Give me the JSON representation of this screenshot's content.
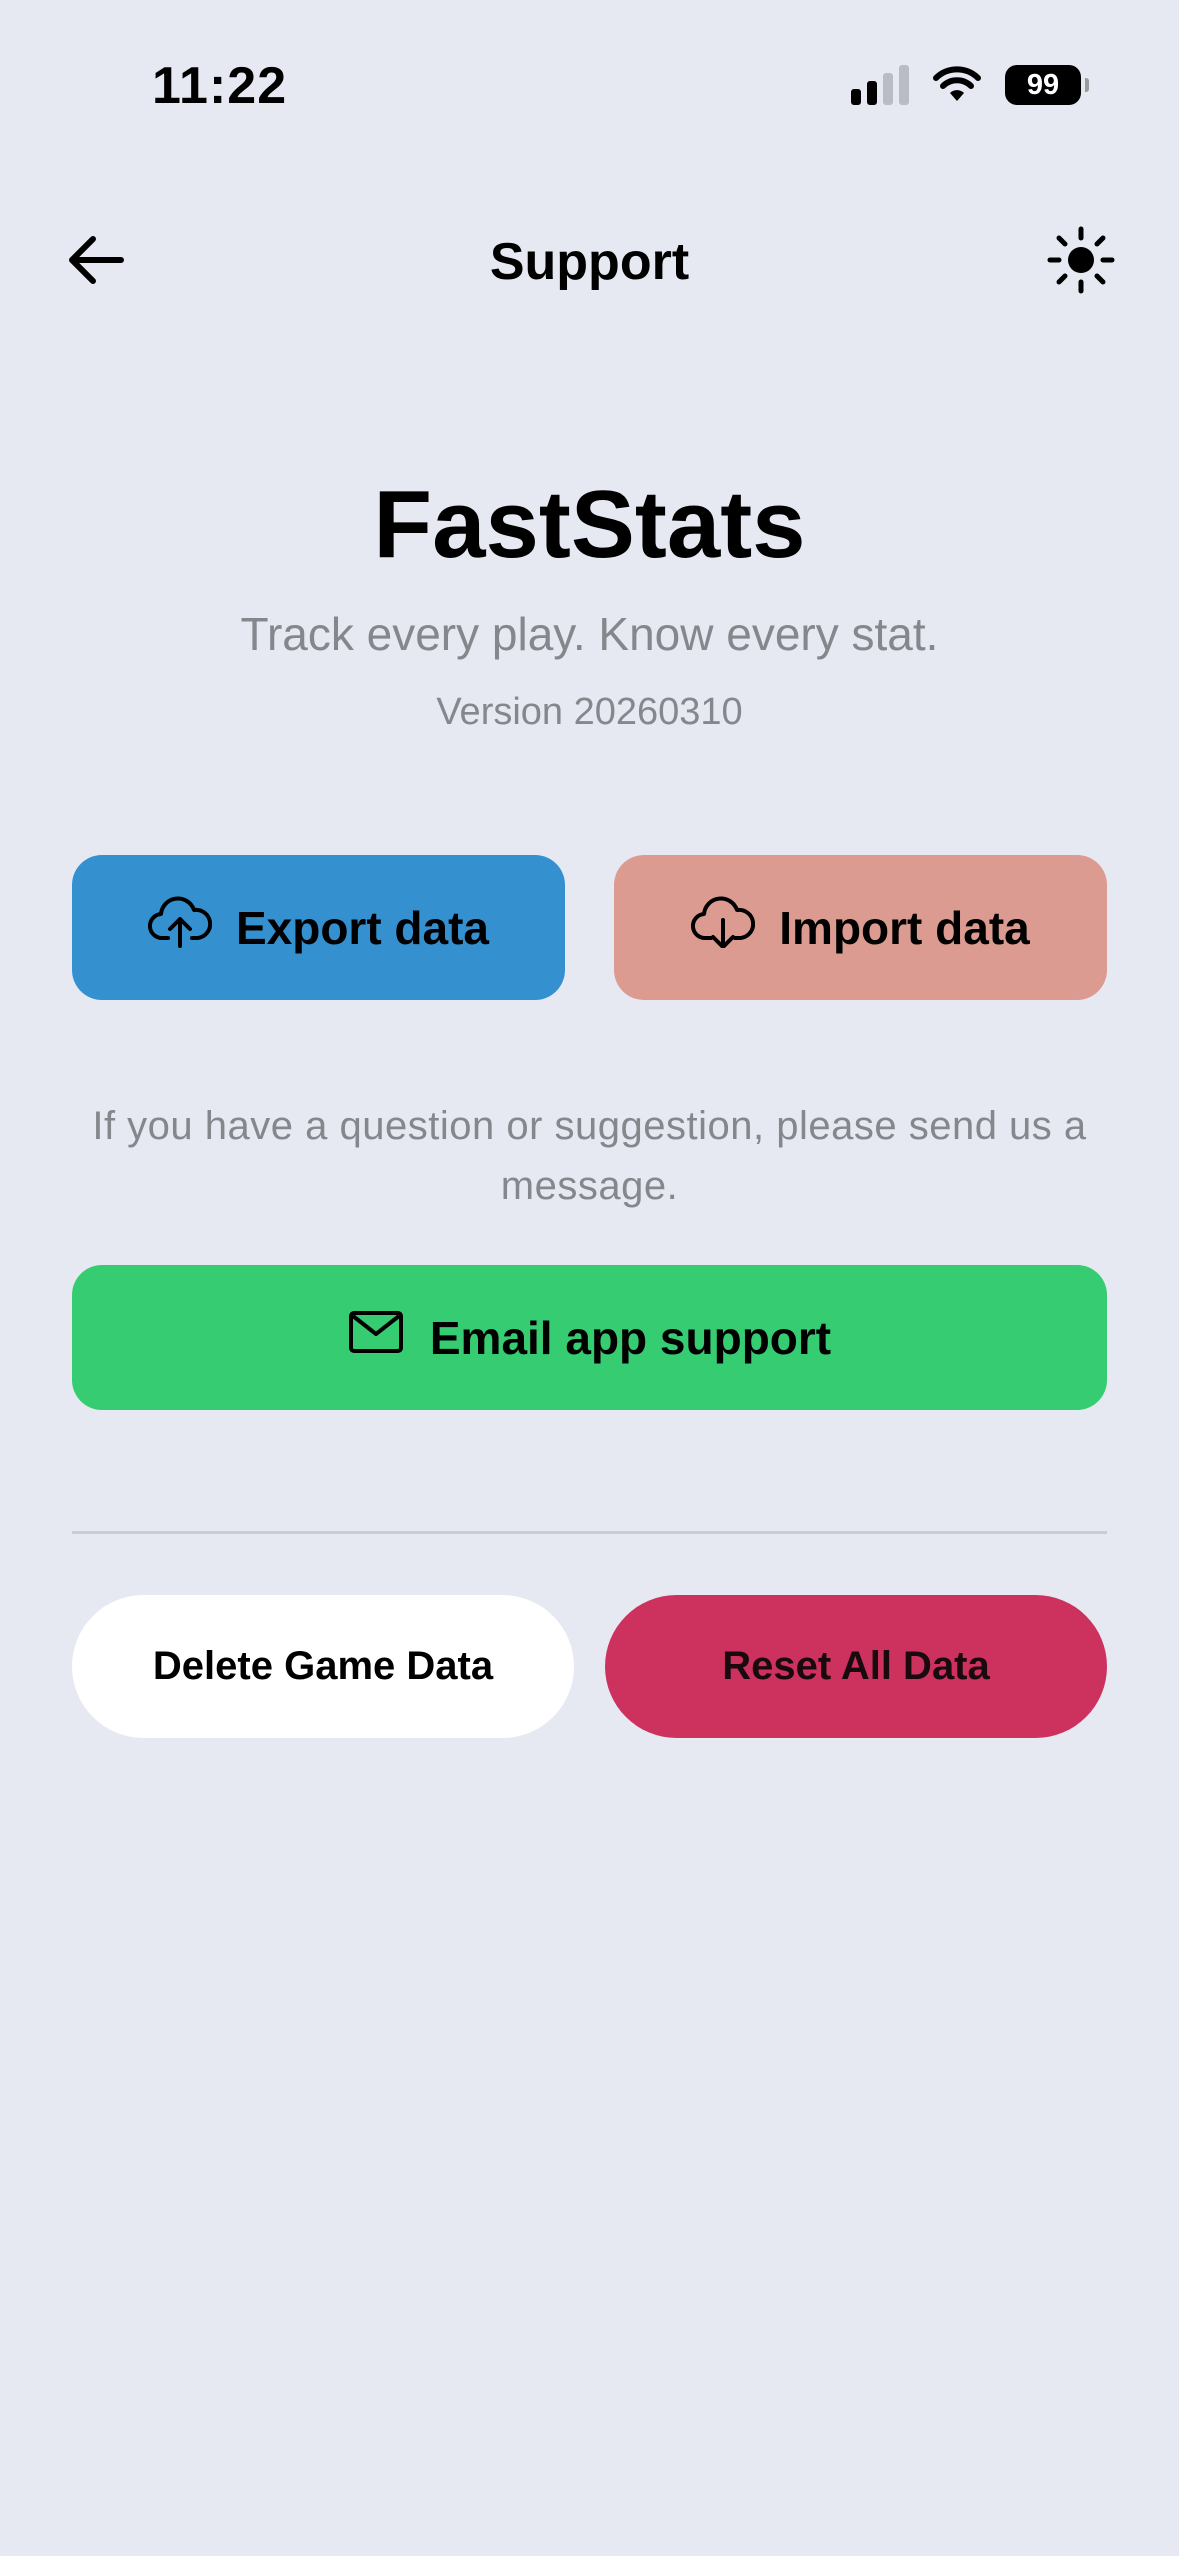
{
  "status_bar": {
    "time": "11:22",
    "battery": "99",
    "signal_bars_active": 2,
    "signal_bars_total": 4,
    "icons": [
      "cellular-signal-icon",
      "wifi-icon",
      "battery-icon"
    ]
  },
  "header": {
    "title": "Support",
    "back_icon": "arrow-left-icon",
    "theme_icon": "sun-icon"
  },
  "app": {
    "name": "FastStats",
    "tagline": "Track every play. Know every stat.",
    "version": "Version 20260310"
  },
  "data_actions": {
    "export_label": "Export data",
    "export_icon": "cloud-upload-icon",
    "import_label": "Import data",
    "import_icon": "cloud-download-icon"
  },
  "support": {
    "help_text": "If you have a question or suggestion, please send us a message.",
    "email_label": "Email app support",
    "email_icon": "mail-icon"
  },
  "danger_zone": {
    "delete_label": "Delete Game Data",
    "reset_label": "Reset All Data"
  },
  "colors": {
    "background": "#e6e9f2",
    "export": "#3590d0",
    "import": "#db9b91",
    "email": "#36cc72",
    "reset": "#cc325d",
    "muted_text": "#86878c"
  }
}
